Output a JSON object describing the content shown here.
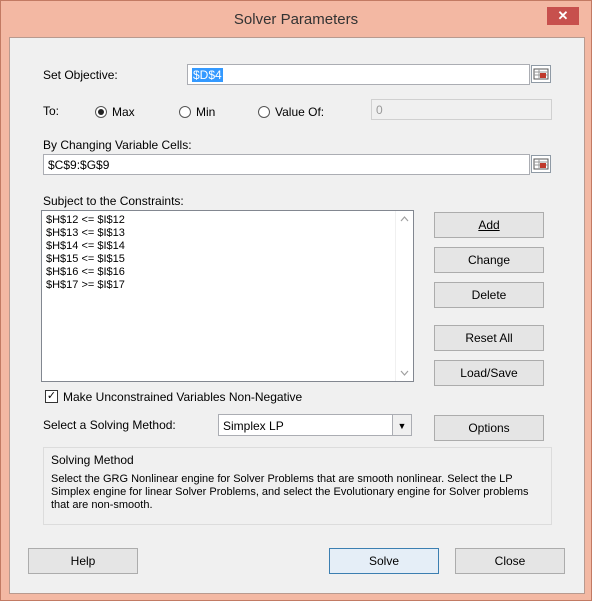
{
  "window": {
    "title": "Solver Parameters",
    "close_glyph": "✕"
  },
  "objective": {
    "label": "Set Objective:",
    "value": "$D$4"
  },
  "to": {
    "label": "To:",
    "options": [
      {
        "label": "Max",
        "selected": true
      },
      {
        "label": "Min",
        "selected": false
      },
      {
        "label": "Value Of:",
        "selected": false
      }
    ],
    "value_of_field": "0"
  },
  "changing_cells": {
    "label": "By Changing Variable Cells:",
    "value": "$C$9:$G$9"
  },
  "constraints": {
    "label": "Subject to the Constraints:",
    "items": [
      "$H$12 <= $I$12",
      "$H$13 <= $I$13",
      "$H$14 <= $I$14",
      "$H$15 <= $I$15",
      "$H$16 <= $I$16",
      "$H$17 >= $I$17"
    ],
    "buttons": {
      "add": "Add",
      "change": "Change",
      "delete": "Delete",
      "reset_all": "Reset All",
      "load_save": "Load/Save"
    }
  },
  "non_negative": {
    "label": "Make Unconstrained Variables Non-Negative",
    "checked": true
  },
  "solving_method": {
    "label": "Select a Solving Method:",
    "selected": "Simplex LP",
    "options_button": "Options"
  },
  "method_info": {
    "title": "Solving Method",
    "description": "Select the GRG Nonlinear engine for Solver Problems that are smooth nonlinear. Select the LP Simplex engine for linear Solver Problems, and select the Evolutionary engine for Solver problems that are non-smooth."
  },
  "footer": {
    "help": "Help",
    "solve": "Solve",
    "close": "Close"
  }
}
